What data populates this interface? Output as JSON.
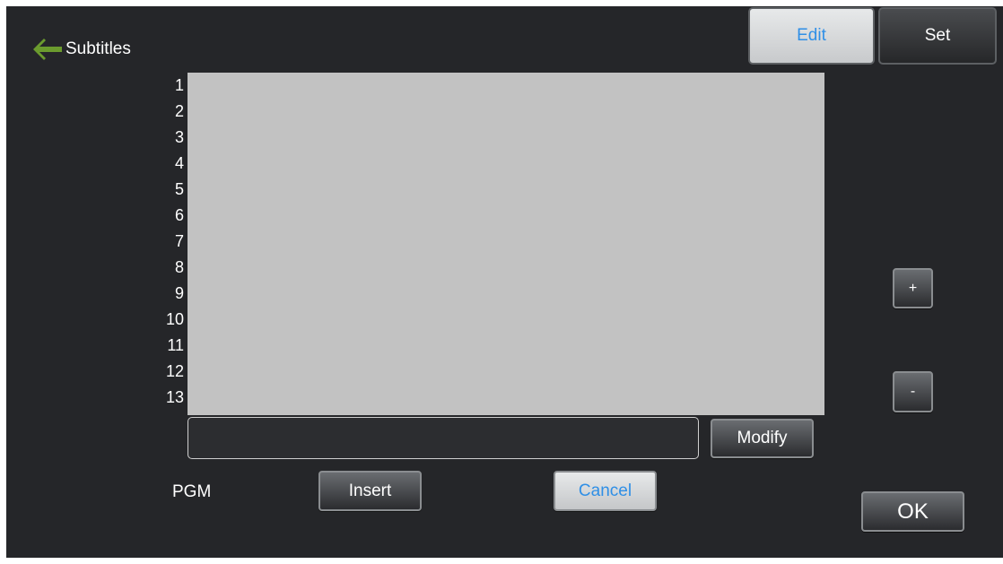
{
  "header": {
    "title": "Subtitles",
    "back_icon": "arrow-left-icon",
    "back_icon_color": "#6b9b2e"
  },
  "tabs": {
    "edit_label": "Edit",
    "set_label": "Set",
    "active": "Edit"
  },
  "editor": {
    "line_numbers": [
      "1",
      "2",
      "3",
      "4",
      "5",
      "6",
      "7",
      "8",
      "9",
      "10",
      "11",
      "12",
      "13"
    ],
    "edit_field_value": ""
  },
  "buttons": {
    "modify_label": "Modify",
    "insert_label": "Insert",
    "cancel_label": "Cancel",
    "plus_label": "+",
    "minus_label": "-",
    "ok_label": "OK"
  },
  "footer": {
    "pgm_label": "PGM"
  },
  "colors": {
    "background": "#252629",
    "text_area": "#c2c2c2",
    "accent": "#2f8fe6"
  }
}
